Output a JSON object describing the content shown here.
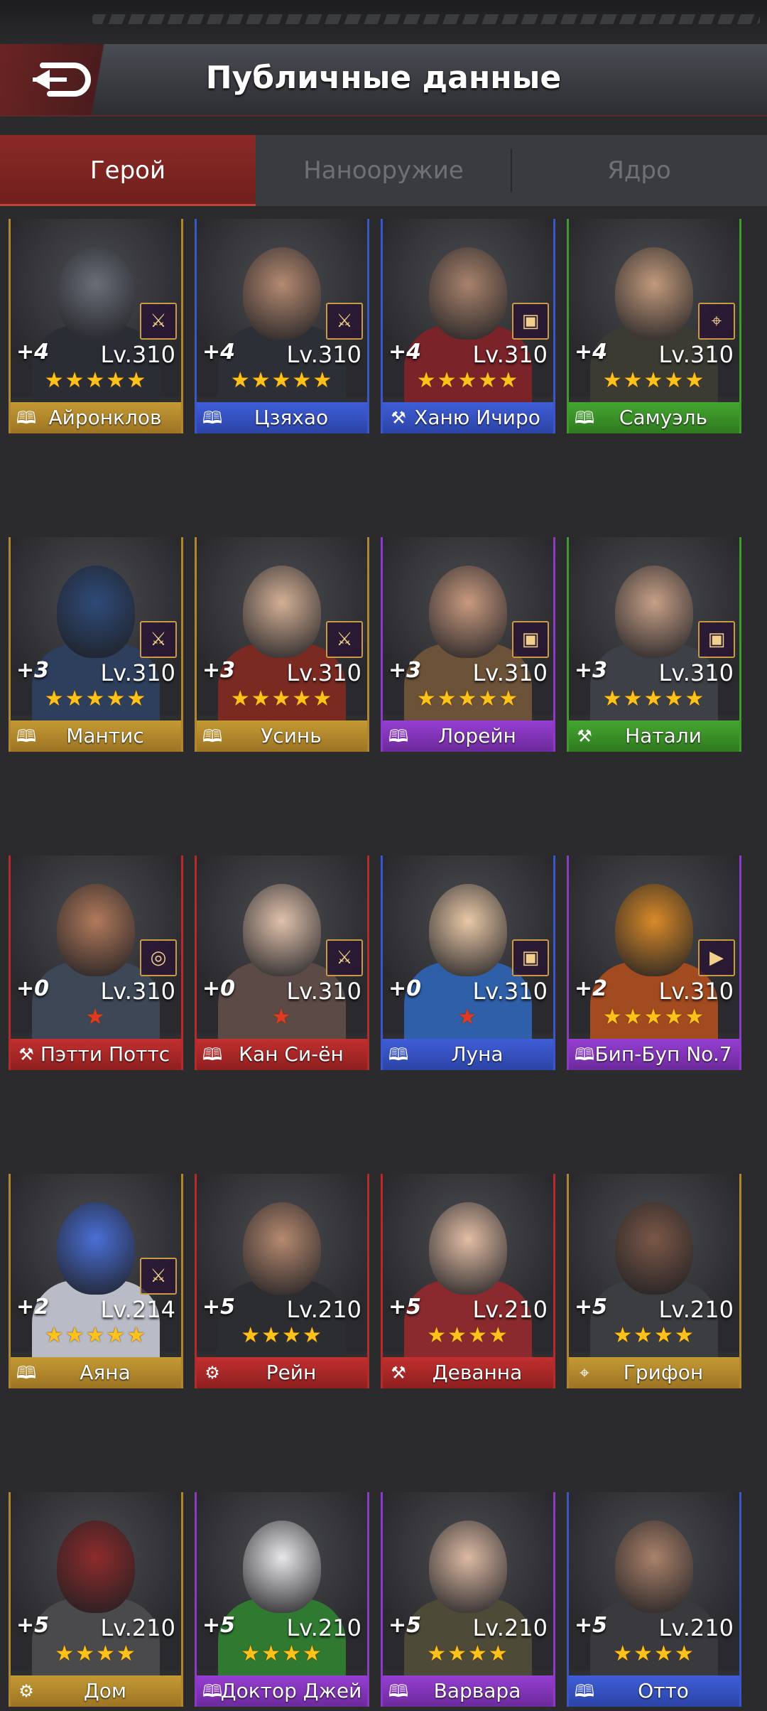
{
  "header": {
    "title": "Публичные данные",
    "back_icon": "back-arrow-icon"
  },
  "tabs": [
    {
      "label": "Герой",
      "active": true
    },
    {
      "label": "Нанооружие",
      "active": false
    },
    {
      "label": "Ядро",
      "active": false
    }
  ],
  "heroes": [
    {
      "name": "Айронклов",
      "plus": "+4",
      "level": "Lv.310",
      "stars": "★★★★★",
      "star_color": "gold",
      "rarity": "gold",
      "class_icon": "book-icon",
      "weapon_icon": "rifle-icon",
      "skin": "#6a6e78",
      "outfit": "#2b2d35"
    },
    {
      "name": "Цзяхао",
      "plus": "+4",
      "level": "Lv.310",
      "stars": "★★★★★",
      "star_color": "gold",
      "rarity": "blue",
      "class_icon": "book-icon",
      "weapon_icon": "rifle-icon",
      "skin": "#b48a72",
      "outfit": "#2d2f36"
    },
    {
      "name": "Ханю Ичиро",
      "plus": "+4",
      "level": "Lv.310",
      "stars": "★★★★★",
      "star_color": "gold",
      "rarity": "blue",
      "class_icon": "axe-icon",
      "weapon_icon": "chest-icon",
      "skin": "#a8836d",
      "outfit": "#7a2328"
    },
    {
      "name": "Самуэль",
      "plus": "+4",
      "level": "Lv.310",
      "stars": "★★★★★",
      "star_color": "gold",
      "rarity": "green",
      "class_icon": "book-icon",
      "weapon_icon": "gun-icon",
      "skin": "#c19a7c",
      "outfit": "#3b3a33"
    },
    {
      "name": "Мантис",
      "plus": "+3",
      "level": "Lv.310",
      "stars": "★★★★★",
      "star_color": "gold",
      "rarity": "gold",
      "class_icon": "book-icon",
      "weapon_icon": "rifle-icon",
      "skin": "#2f4b78",
      "outfit": "#2e3f5e"
    },
    {
      "name": "Усинь",
      "plus": "+3",
      "level": "Lv.310",
      "stars": "★★★★★",
      "star_color": "gold",
      "rarity": "gold",
      "class_icon": "book-icon",
      "weapon_icon": "rifle-icon",
      "skin": "#d3b096",
      "outfit": "#7b2a22"
    },
    {
      "name": "Лорейн",
      "plus": "+3",
      "level": "Lv.310",
      "stars": "★★★★★",
      "star_color": "gold",
      "rarity": "purple",
      "class_icon": "book-icon",
      "weapon_icon": "chest-icon",
      "skin": "#c89a80",
      "outfit": "#6b5238"
    },
    {
      "name": "Натали",
      "plus": "+3",
      "level": "Lv.310",
      "stars": "★★★★★",
      "star_color": "gold",
      "rarity": "green",
      "class_icon": "axe-icon",
      "weapon_icon": "chest-icon",
      "skin": "#c6a088",
      "outfit": "#3d4046"
    },
    {
      "name": "Пэтти Поттс",
      "plus": "+0",
      "level": "Lv.310",
      "stars": "★",
      "star_color": "red",
      "rarity": "red",
      "class_icon": "axe-icon",
      "weapon_icon": "pan-icon",
      "skin": "#b17a5c",
      "outfit": "#3d4756"
    },
    {
      "name": "Кан Си-ён",
      "plus": "+0",
      "level": "Lv.310",
      "stars": "★",
      "star_color": "red",
      "rarity": "red",
      "class_icon": "book-icon",
      "weapon_icon": "rifle-icon",
      "skin": "#e0c2ad",
      "outfit": "#5b4a45"
    },
    {
      "name": "Луна",
      "plus": "+0",
      "level": "Lv.310",
      "stars": "★",
      "star_color": "red",
      "rarity": "blue",
      "class_icon": "book-icon",
      "weapon_icon": "chest-icon",
      "skin": "#e9c9a8",
      "outfit": "#2f5fa8"
    },
    {
      "name": "Бип-Буп No.7",
      "plus": "+2",
      "level": "Lv.310",
      "stars": "★★★★★",
      "star_color": "gold",
      "rarity": "purple",
      "class_icon": "book-icon",
      "weapon_icon": "drill-icon",
      "skin": "#d88a2a",
      "outfit": "#a24a20"
    },
    {
      "name": "Аяна",
      "plus": "+2",
      "level": "Lv.214",
      "stars": "★★★★★",
      "star_color": "gold",
      "rarity": "gold",
      "class_icon": "book-icon",
      "weapon_icon": "rifle-icon",
      "skin": "#4a6fd6",
      "outfit": "#b9bcc6"
    },
    {
      "name": "Рейн",
      "plus": "+5",
      "level": "Lv.210",
      "stars": "★★★★",
      "star_color": "gold",
      "rarity": "red",
      "class_icon": "bike-icon",
      "weapon_icon": "",
      "skin": "#b58a70",
      "outfit": "#2c2d31"
    },
    {
      "name": "Деванна",
      "plus": "+5",
      "level": "Lv.210",
      "stars": "★★★★",
      "star_color": "gold",
      "rarity": "red",
      "class_icon": "axe-icon",
      "weapon_icon": "",
      "skin": "#e2bea6",
      "outfit": "#8a2a2e"
    },
    {
      "name": "Грифон",
      "plus": "+5",
      "level": "Lv.210",
      "stars": "★★★★",
      "star_color": "gold",
      "rarity": "gold",
      "class_icon": "gun-icon",
      "weapon_icon": "",
      "skin": "#7a5848",
      "outfit": "#3b3d40"
    },
    {
      "name": "Дом",
      "plus": "+5",
      "level": "Lv.210",
      "stars": "★★★★",
      "star_color": "gold",
      "rarity": "gold",
      "class_icon": "bike-icon",
      "weapon_icon": "",
      "skin": "#8d2c2c",
      "outfit": "#4a4a4c"
    },
    {
      "name": "Доктор Джей",
      "plus": "+5",
      "level": "Lv.210",
      "stars": "★★★★",
      "star_color": "gold",
      "rarity": "purple",
      "class_icon": "book-icon",
      "weapon_icon": "",
      "skin": "#e8e8ea",
      "outfit": "#2f7a30"
    },
    {
      "name": "Варвара",
      "plus": "+5",
      "level": "Lv.210",
      "stars": "★★★★",
      "star_color": "gold",
      "rarity": "purple",
      "class_icon": "book-icon",
      "weapon_icon": "",
      "skin": "#dcbaa4",
      "outfit": "#4d4a38"
    },
    {
      "name": "Отто",
      "plus": "+5",
      "level": "Lv.210",
      "stars": "★★★★",
      "star_color": "gold",
      "rarity": "blue",
      "class_icon": "book-icon",
      "weapon_icon": "",
      "skin": "#a9826b",
      "outfit": "#3a3a3e"
    }
  ]
}
